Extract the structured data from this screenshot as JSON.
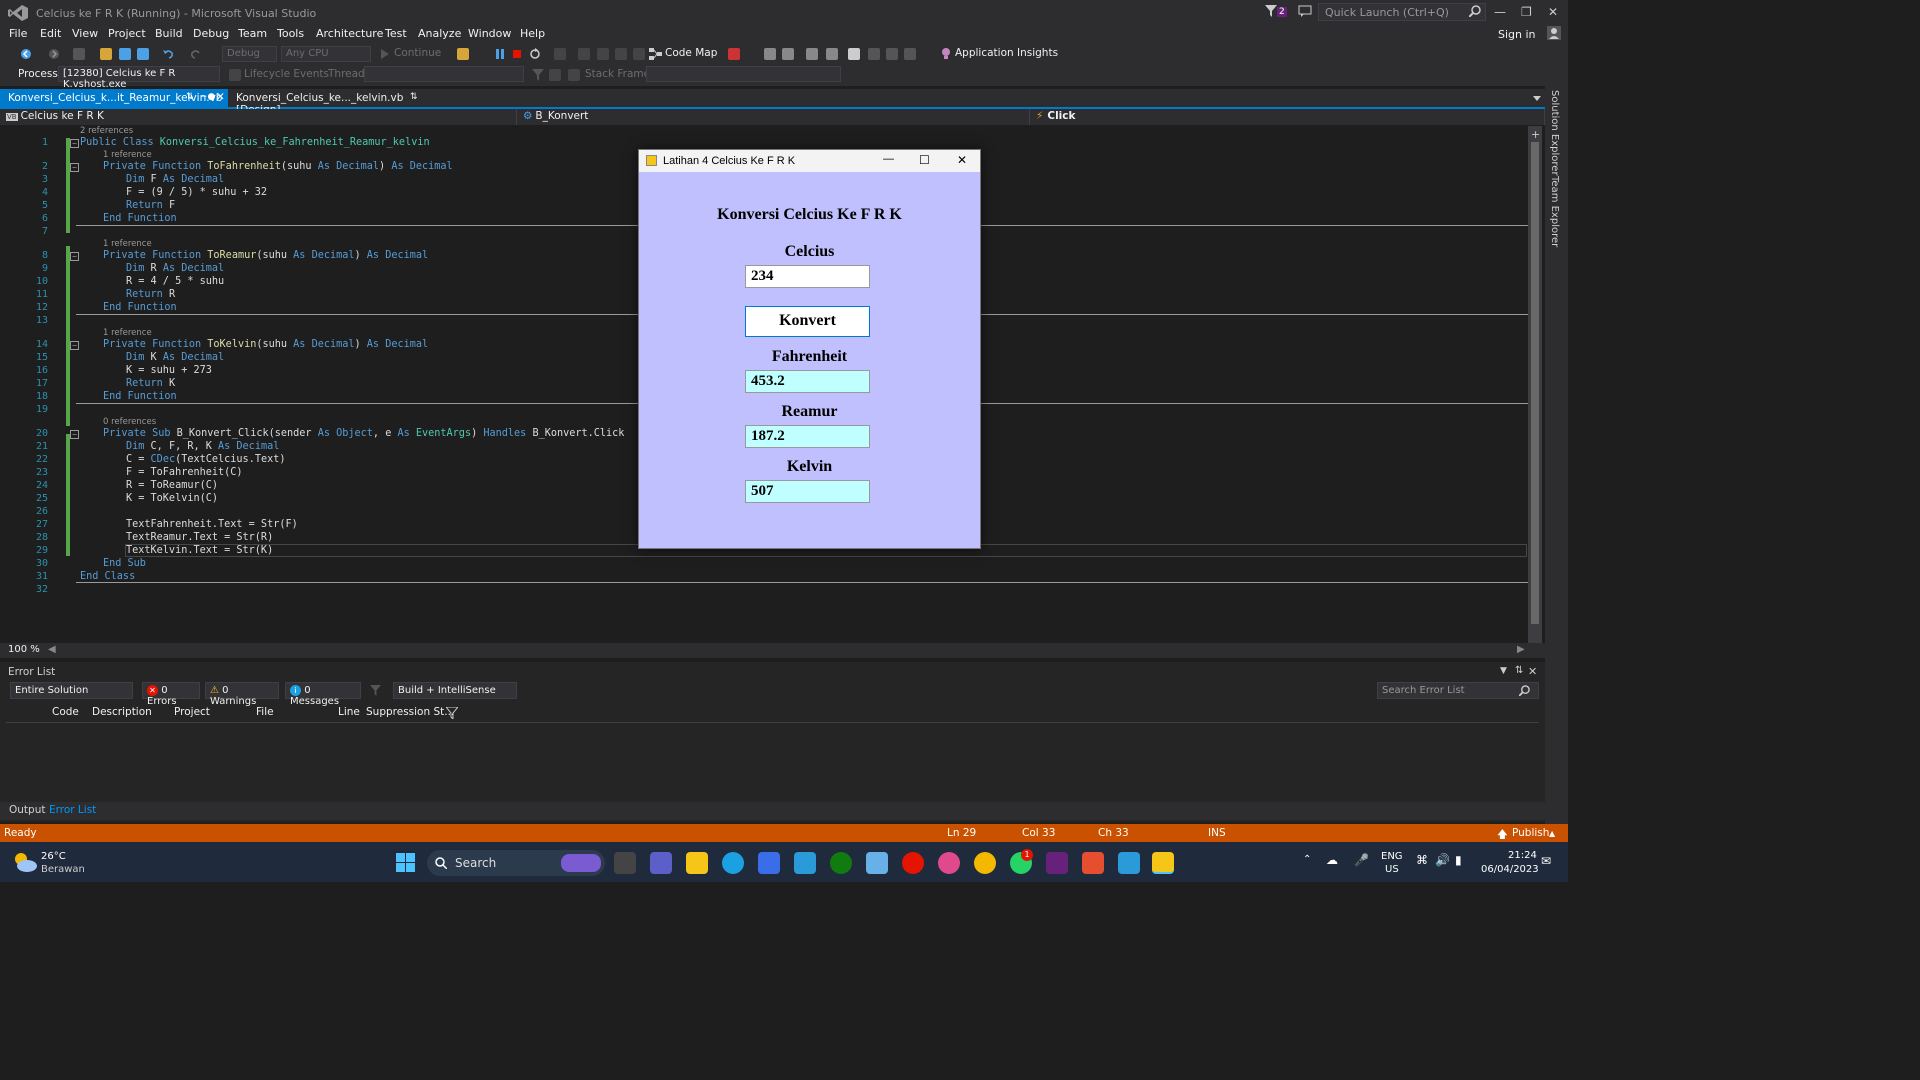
{
  "window": {
    "title": "Celcius ke F R K (Running) - Microsoft Visual Studio",
    "quick_launch": "Quick Launch (Ctrl+Q)",
    "notifications": "2",
    "sign_in": "Sign in"
  },
  "menu": [
    "File",
    "Edit",
    "View",
    "Project",
    "Build",
    "Debug",
    "Team",
    "Tools",
    "Architecture",
    "Test",
    "Analyze",
    "Window",
    "Help"
  ],
  "toolbar": {
    "config": "Debug",
    "platform": "Any CPU",
    "continue": "Continue",
    "code_map": "Code Map",
    "app_insights": "Application Insights"
  },
  "toolbar2": {
    "process_label": "Process:",
    "process_value": "[12380] Celcius ke F R K.vshost.exe",
    "lifecycle": "Lifecycle Events",
    "thread_label": "Thread:",
    "stack_label": "Stack Frame:"
  },
  "tabs": [
    {
      "label": "Konversi_Celcius_k...it_Reamur_kelvin.vb"
    },
    {
      "label": "Konversi_Celcius_ke..._kelvin.vb [Design]"
    }
  ],
  "nav": {
    "project": "Celcius ke F R K",
    "object": "B_Konvert",
    "event": "Click"
  },
  "code": {
    "refs": {
      "r1": "2 references",
      "r2": "1 reference",
      "r8": "1 reference",
      "r14": "1 reference",
      "r20": "0 references"
    },
    "lines": [
      "1",
      "2",
      "3",
      "4",
      "5",
      "6",
      "7",
      "8",
      "9",
      "10",
      "11",
      "12",
      "13",
      "14",
      "15",
      "16",
      "17",
      "18",
      "19",
      "20",
      "21",
      "22",
      "23",
      "24",
      "25",
      "26",
      "27",
      "28",
      "29",
      "30",
      "31",
      "32"
    ],
    "l1_a": "Public Class ",
    "l1_b": "Konversi_Celcius_ke_Fahrenheit_Reamur_kelvin",
    "l2_a": "Private Function ",
    "l2_b": "ToFahrenheit",
    "l2_c": "(suhu ",
    "l2_d": "As Decimal",
    "l2_e": ") ",
    "l2_f": "As Decimal",
    "l3_a": "Dim ",
    "l3_b": "F ",
    "l3_c": "As Decimal",
    "l4": "F = (9 / 5) * suhu + 32",
    "l5_a": "Return ",
    "l5_b": "F",
    "l6": "End Function",
    "l8_a": "Private Function ",
    "l8_b": "ToReamur",
    "l8_c": "(suhu ",
    "l8_d": "As Decimal",
    "l8_e": ") ",
    "l8_f": "As Decimal",
    "l9_a": "Dim ",
    "l9_b": "R ",
    "l9_c": "As Decimal",
    "l10": "R = 4 / 5 * suhu",
    "l11_a": "Return ",
    "l11_b": "R",
    "l12": "End Function",
    "l14_a": "Private Function ",
    "l14_b": "ToKelvin",
    "l14_c": "(suhu ",
    "l14_d": "As Decimal",
    "l14_e": ") ",
    "l14_f": "As Decimal",
    "l15_a": "Dim ",
    "l15_b": "K ",
    "l15_c": "As Decimal",
    "l16": "K = suhu + 273",
    "l17_a": "Return ",
    "l17_b": "K",
    "l18": "End Function",
    "l20_a": "Private Sub ",
    "l20_b": "B_Konvert_Click",
    "l20_c": "(sender ",
    "l20_d": "As ",
    "l20_e": "Object",
    "l20_f": ", e ",
    "l20_g": "As ",
    "l20_h": "EventArgs",
    "l20_i": ") ",
    "l20_j": "Handles ",
    "l20_k": "B_Konvert.Click",
    "l21_a": "Dim ",
    "l21_b": "C, F, R, K ",
    "l21_c": "As Decimal",
    "l22_a": "C = ",
    "l22_b": "CDec",
    "l22_c": "(TextCelcius.Text)",
    "l23": "F = ToFahrenheit(C)",
    "l24": "R = ToReamur(C)",
    "l25": "K = ToKelvin(C)",
    "l27": "TextFahrenheit.Text = Str(F)",
    "l28": "TextReamur.Text = Str(R)",
    "l29": "TextKelvin.Text = Str(K)",
    "l30": "End Sub",
    "l31": "End Class"
  },
  "zoom": "100 %",
  "error_list": {
    "title": "Error List",
    "scope": "Entire Solution",
    "errors": "0 Errors",
    "warnings": "0 Warnings",
    "messages": "0 Messages",
    "build": "Build + IntelliSense",
    "search": "Search Error List",
    "columns": [
      "Code",
      "Description",
      "Project",
      "File",
      "Line",
      "Suppression St..."
    ]
  },
  "bottom_tabs": [
    "Output",
    "Error List"
  ],
  "side_panel": [
    "Solution Explorer",
    "Team Explorer"
  ],
  "status": {
    "ready": "Ready",
    "ln": "Ln 29",
    "col": "Col 33",
    "ch": "Ch 33",
    "ins": "INS",
    "publish": "Publish"
  },
  "dialog": {
    "title": "Latihan 4 Celcius Ke F R K",
    "heading": "Konversi Celcius Ke F R K",
    "celcius_label": "Celcius",
    "celcius_value": "234",
    "button": "Konvert",
    "fahrenheit_label": "Fahrenheit",
    "fahrenheit_value": "453.2",
    "reamur_label": "Reamur",
    "reamur_value": "187.2",
    "kelvin_label": "Kelvin",
    "kelvin_value": "507"
  },
  "taskbar": {
    "weather_temp": "26°C",
    "weather_desc": "Berawan",
    "search": "Search",
    "lang": "ENG",
    "region": "US",
    "time": "21:24",
    "date": "06/04/2023",
    "badge": "1"
  },
  "colors": {
    "editor_bg": "#1e1e1e",
    "status_bar": "#ca5100",
    "dialog_bg": "#c0c0ff",
    "output_field_bg": "#c0ffff",
    "keyword": "#569cd6",
    "type": "#4ec9b0"
  }
}
